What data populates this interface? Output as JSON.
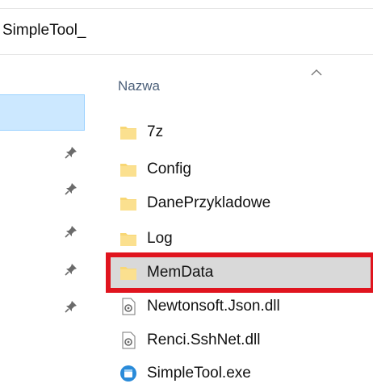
{
  "address": {
    "path": "SimpleTool_"
  },
  "columns": {
    "name_header": "Nazwa"
  },
  "files": [
    {
      "name": "7z",
      "type": "folder"
    },
    {
      "name": "Config",
      "type": "folder"
    },
    {
      "name": "DanePrzykladowe",
      "type": "folder"
    },
    {
      "name": "Log",
      "type": "folder"
    },
    {
      "name": "MemData",
      "type": "folder",
      "selected": true
    },
    {
      "name": "Newtonsoft.Json.dll",
      "type": "dll"
    },
    {
      "name": "Renci.SshNet.dll",
      "type": "dll"
    },
    {
      "name": "SimpleTool.exe",
      "type": "exe"
    }
  ],
  "colors": {
    "folder": "#f8d775",
    "highlight_border": "#e0141e",
    "selection_bg": "#d9d9d9",
    "nav_selected": "#cce8ff"
  }
}
